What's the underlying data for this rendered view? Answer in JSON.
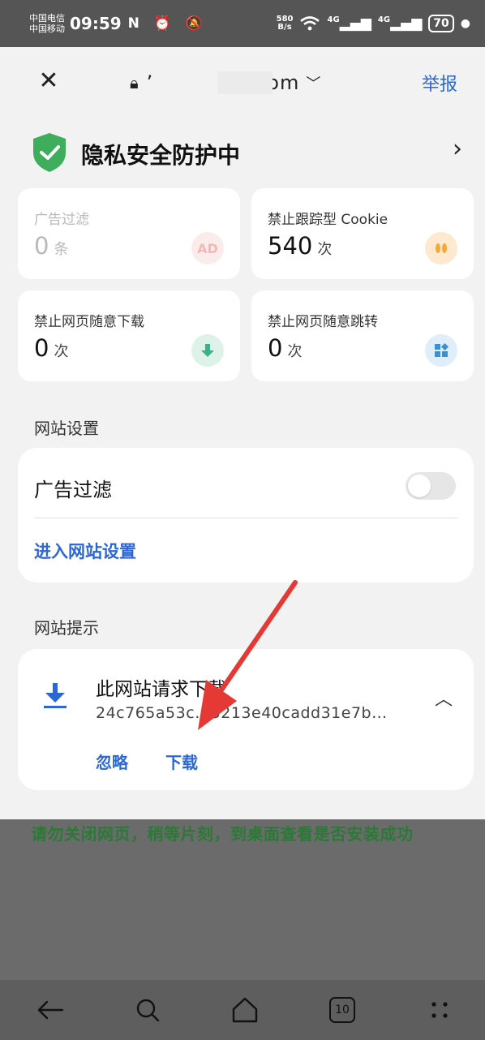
{
  "status_bar": {
    "carrier1": "中国电信",
    "carrier2": "中国移动",
    "time": "09:59",
    "left_icons": "N ⏰ 🔕",
    "net_speed_value": "580",
    "net_speed_unit": "B/s",
    "wifi_icon": "wifi-icon",
    "signal1": "4G",
    "signal2": "4G",
    "battery": "70"
  },
  "header": {
    "url_start": "ʼ",
    "url_end": "om",
    "report_label": "举报"
  },
  "privacy": {
    "title": "隐私安全防护中"
  },
  "stats": [
    {
      "label": "广告过滤",
      "value": "0",
      "unit": "条",
      "icon": "AD"
    },
    {
      "label": "禁止跟踪型 Cookie",
      "value": "540",
      "unit": "次",
      "icon": "footprints-icon"
    },
    {
      "label": "禁止网页随意下载",
      "value": "0",
      "unit": "次",
      "icon": "download-arrow-icon"
    },
    {
      "label": "禁止网页随意跳转",
      "value": "0",
      "unit": "次",
      "icon": "jump-icon"
    }
  ],
  "website_settings": {
    "section_title": "网站设置",
    "ad_filter_label": "广告过滤",
    "ad_filter_on": false,
    "enter_settings": "进入网站设置"
  },
  "website_hints": {
    "section_title": "网站提示",
    "download_title": "此网站请求下载",
    "download_hash": "24c765a53c…3213e40cadd31e7b…",
    "ignore_label": "忽略",
    "download_label": "下载"
  },
  "background_page": {
    "notice": "请勿关闭网页，稍等片刻，到桌面查看是否安装成功"
  },
  "navbar": {
    "tabs_count": "10"
  },
  "colors": {
    "accent": "#2b67d6",
    "shield_green": "#3fae5c",
    "sheet_bg": "#f2f2f2",
    "arrow_red": "#e53935"
  }
}
